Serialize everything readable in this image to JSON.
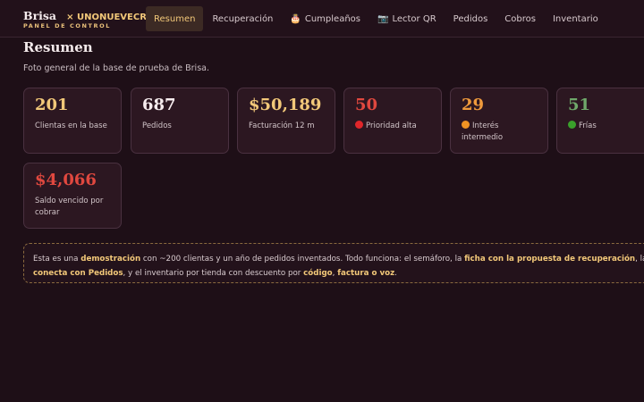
{
  "brand": {
    "name": "Brisa",
    "partner": "× UNONUEVECR",
    "subtitle": "PANEL DE CONTROL"
  },
  "nav": [
    {
      "label": "Resumen",
      "icon": "",
      "active": true
    },
    {
      "label": "Recuperación",
      "icon": "",
      "active": false
    },
    {
      "label": "Cumpleaños",
      "icon": "🎂",
      "active": false
    },
    {
      "label": "Lector QR",
      "icon": "📷",
      "active": false
    },
    {
      "label": "Pedidos",
      "icon": "",
      "active": false
    },
    {
      "label": "Cobros",
      "icon": "",
      "active": false
    },
    {
      "label": "Inventario",
      "icon": "",
      "active": false
    }
  ],
  "page": {
    "title": "Resumen",
    "description": "Foto general de la base de prueba de Brisa."
  },
  "cards": [
    {
      "value": "201",
      "label": "Clientas en la base",
      "color": "#f2c879"
    },
    {
      "value": "687",
      "label": "Pedidos",
      "color": "#f6ecee"
    },
    {
      "value": "$50,189",
      "label": "Facturación 12 m",
      "color": "#f2c879"
    },
    {
      "value": "50",
      "label": "Prioridad alta",
      "color": "#e0483f",
      "dot": "#e0262a"
    },
    {
      "value": "29",
      "label": "Interés intermedio",
      "color": "#ef9a3c",
      "dot": "#f09323"
    },
    {
      "value": "51",
      "label": "Frías",
      "color": "#6fa86a",
      "dot": "#3aa02b"
    },
    {
      "value": "$4,066",
      "label": "Saldo vencido por cobrar",
      "color": "#e0483f"
    }
  ],
  "note": {
    "l1_a": "Esta es una ",
    "l1_b": "demostración",
    "l1_c": " con ~200 clientas y un año de pedidos inventados. Todo funciona: el semáforo, la ",
    "l1_d": "ficha con la propuesta de recuperación",
    "l1_e": ", la co",
    "l2_a": "conecta con Pedidos",
    "l2_b": ", y el inventario por tienda con descuento por ",
    "l2_c": "código",
    "l2_d": ", ",
    "l2_e": "factura o voz",
    "l2_f": "."
  }
}
